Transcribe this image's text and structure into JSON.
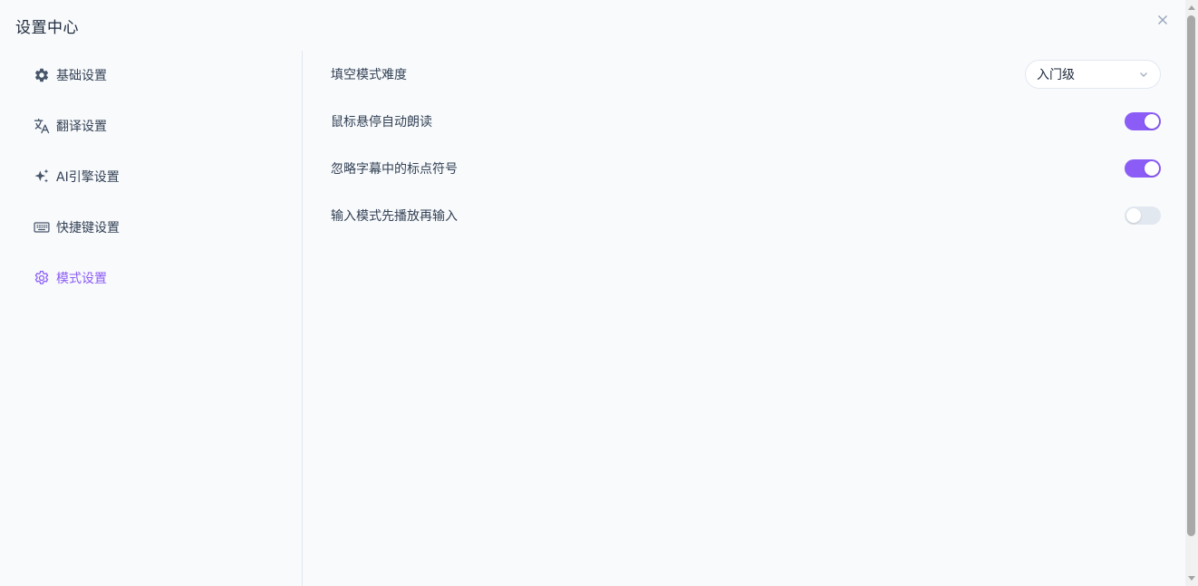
{
  "window": {
    "title": "设置中心"
  },
  "sidebar": {
    "items": [
      {
        "label": "基础设置",
        "icon": "gear-icon",
        "active": false
      },
      {
        "label": "翻译设置",
        "icon": "translate-icon",
        "active": false
      },
      {
        "label": "AI引擎设置",
        "icon": "sparkles-icon",
        "active": false
      },
      {
        "label": "快捷键设置",
        "icon": "keyboard-icon",
        "active": false
      },
      {
        "label": "模式设置",
        "icon": "cog-outline-icon",
        "active": true
      }
    ]
  },
  "main": {
    "settings": [
      {
        "label": "填空模式难度",
        "control": "select",
        "value": "入门级"
      },
      {
        "label": "鼠标悬停自动朗读",
        "control": "toggle",
        "on": true
      },
      {
        "label": "忽略字幕中的标点符号",
        "control": "toggle",
        "on": true
      },
      {
        "label": "输入模式先播放再输入",
        "control": "toggle",
        "on": false
      }
    ]
  },
  "colors": {
    "accent": "#8b5cf6",
    "toggle_off": "#e2e8f0",
    "background": "#f8fafc"
  }
}
